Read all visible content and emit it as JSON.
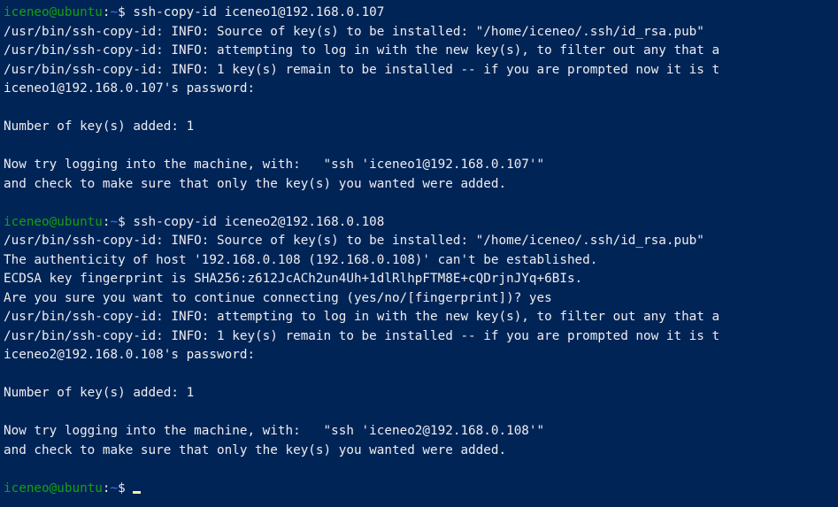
{
  "terminal": {
    "background": "#012456",
    "prompt_user_color": "#13a10e",
    "prompt_path_color": "#3b78ff",
    "cursor_color": "#f9f1a5",
    "lines": [
      {
        "type": "prompt",
        "user": "iceneo@ubuntu",
        "sep": ":",
        "path": "~",
        "sym": "$ ",
        "cmd": "ssh-copy-id iceneo1@192.168.0.107"
      },
      {
        "type": "text",
        "text": "/usr/bin/ssh-copy-id: INFO: Source of key(s) to be installed: \"/home/iceneo/.ssh/id_rsa.pub\""
      },
      {
        "type": "text",
        "text": "/usr/bin/ssh-copy-id: INFO: attempting to log in with the new key(s), to filter out any that a"
      },
      {
        "type": "text",
        "text": "/usr/bin/ssh-copy-id: INFO: 1 key(s) remain to be installed -- if you are prompted now it is t"
      },
      {
        "type": "text",
        "text": "iceneo1@192.168.0.107's password:"
      },
      {
        "type": "text",
        "text": ""
      },
      {
        "type": "text",
        "text": "Number of key(s) added: 1"
      },
      {
        "type": "text",
        "text": ""
      },
      {
        "type": "text",
        "text": "Now try logging into the machine, with:   \"ssh 'iceneo1@192.168.0.107'\""
      },
      {
        "type": "text",
        "text": "and check to make sure that only the key(s) you wanted were added."
      },
      {
        "type": "text",
        "text": ""
      },
      {
        "type": "prompt",
        "user": "iceneo@ubuntu",
        "sep": ":",
        "path": "~",
        "sym": "$ ",
        "cmd": "ssh-copy-id iceneo2@192.168.0.108"
      },
      {
        "type": "text",
        "text": "/usr/bin/ssh-copy-id: INFO: Source of key(s) to be installed: \"/home/iceneo/.ssh/id_rsa.pub\""
      },
      {
        "type": "text",
        "text": "The authenticity of host '192.168.0.108 (192.168.0.108)' can't be established."
      },
      {
        "type": "text",
        "text": "ECDSA key fingerprint is SHA256:z612JcACh2un4Uh+1dlRlhpFTM8E+cQDrjnJYq+6BIs."
      },
      {
        "type": "text",
        "text": "Are you sure you want to continue connecting (yes/no/[fingerprint])? yes"
      },
      {
        "type": "text",
        "text": "/usr/bin/ssh-copy-id: INFO: attempting to log in with the new key(s), to filter out any that a"
      },
      {
        "type": "text",
        "text": "/usr/bin/ssh-copy-id: INFO: 1 key(s) remain to be installed -- if you are prompted now it is t"
      },
      {
        "type": "text",
        "text": "iceneo2@192.168.0.108's password:"
      },
      {
        "type": "text",
        "text": ""
      },
      {
        "type": "text",
        "text": "Number of key(s) added: 1"
      },
      {
        "type": "text",
        "text": ""
      },
      {
        "type": "text",
        "text": "Now try logging into the machine, with:   \"ssh 'iceneo2@192.168.0.108'\""
      },
      {
        "type": "text",
        "text": "and check to make sure that only the key(s) you wanted were added."
      },
      {
        "type": "text",
        "text": ""
      },
      {
        "type": "prompt",
        "user": "iceneo@ubuntu",
        "sep": ":",
        "path": "~",
        "sym": "$ ",
        "cmd": "",
        "cursor": true
      }
    ]
  }
}
